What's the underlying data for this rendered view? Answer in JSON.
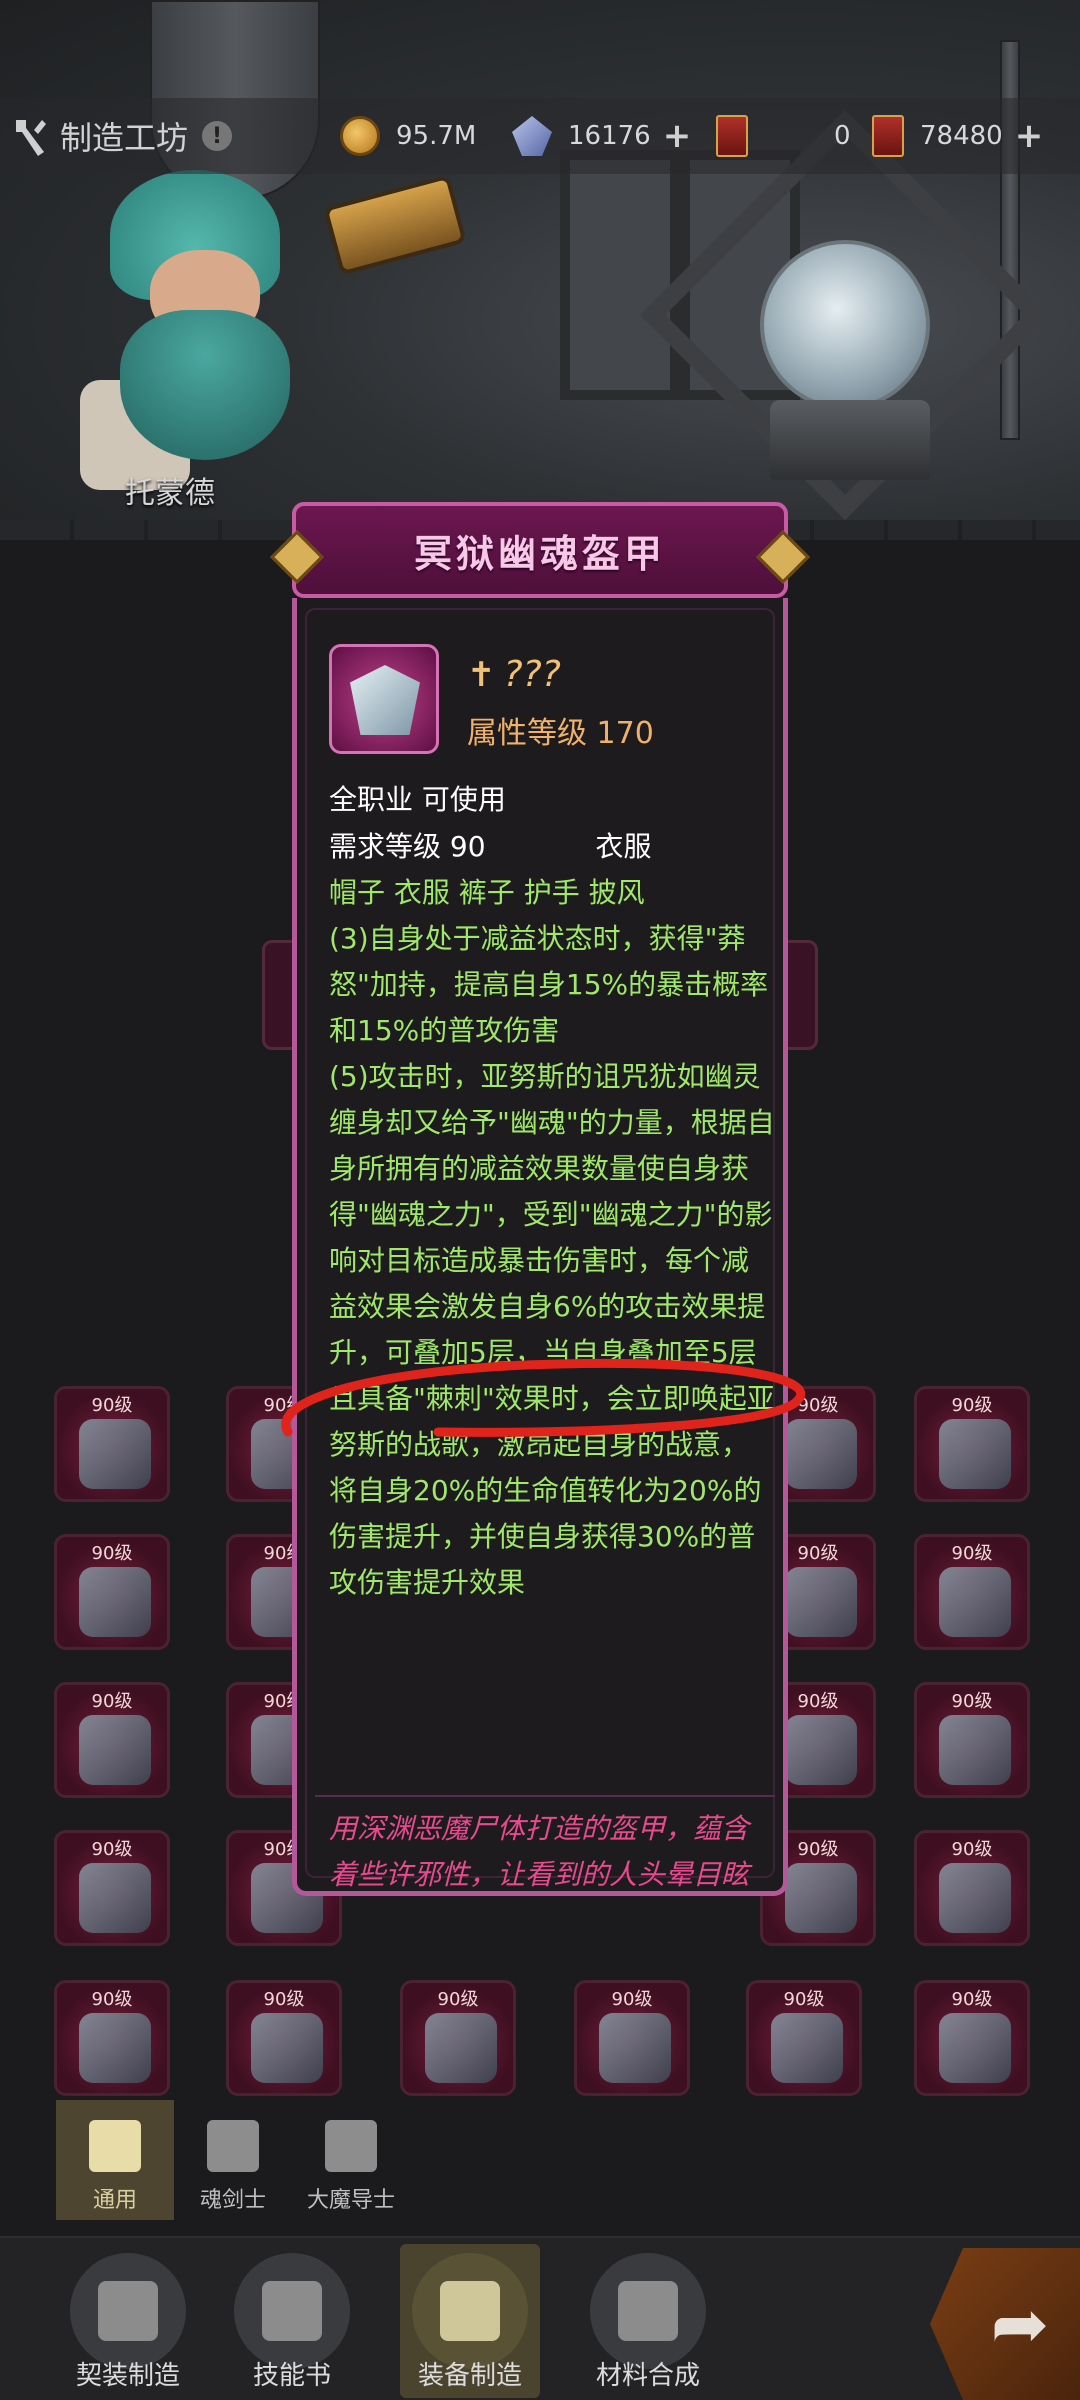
{
  "topbar": {
    "title": "制造工坊",
    "gold": "95.7M",
    "crystal": "16176",
    "ticket_a": "0",
    "ticket_b": "78480"
  },
  "scene": {
    "npc_name": "托蒙德"
  },
  "tooltip": {
    "title": "冥狱幽魂盔甲",
    "unknown": "???",
    "attr_level": "属性等级 170",
    "usable": "全职业 可使用",
    "req_level": "需求等级 90",
    "slot_type": "衣服",
    "set_parts": "帽子 衣服 裤子 护手 披风",
    "effect3": "(3)自身处于减益状态时，获得\"莽怒\"加持，提高自身15%的暴击概率和15%的普攻伤害",
    "effect5": "(5)攻击时，亚努斯的诅咒犹如幽灵缠身却又给予\"幽魂\"的力量，根据自身所拥有的减益效果数量使自身获得\"幽魂之力\"，受到\"幽魂之力\"的影响对目标造成暴击伤害时，每个减益效果会激发自身6%的攻击效果提升，可叠加5层，当自身叠加至5层且具备\"棘刺\"效果时，会立即唤起亚努斯的战歌，激昂起自身的战意，将自身20%的生命值转化为20%的伤害提升，并使自身获得30%的普攻伤害提升效果",
    "flavor": "用深渊恶魔尸体打造的盔甲，蕴含着些许邪性，让看到的人头晕目眩"
  },
  "grid_level_label": "90级",
  "class_tabs": [
    "通用",
    "魂剑士",
    "大魔导士"
  ],
  "bottom_nav": [
    "契装制造",
    "技能书",
    "装备制造",
    "材料合成"
  ],
  "icons": {
    "hammer": "hammer-icon",
    "coin": "coin-icon",
    "crystal": "crystal-icon",
    "ticket": "ticket-icon",
    "arrow": "arrow-right-icon"
  }
}
